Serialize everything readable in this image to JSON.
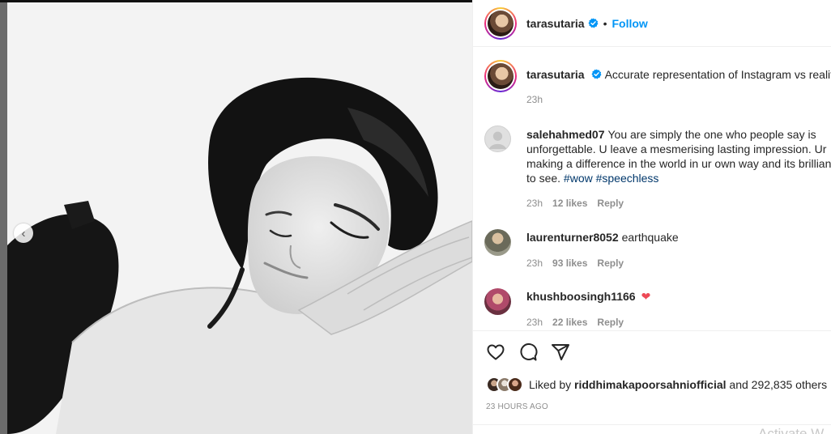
{
  "post": {
    "image_alt": "Black and white portrait of a woman resting her head on her hands"
  },
  "header": {
    "username": "tarasutaria",
    "separator": "•",
    "follow_label": "Follow"
  },
  "caption": {
    "username": "tarasutaria",
    "text": "Accurate representation of Instagram vs reality",
    "time": "23h"
  },
  "comments": [
    {
      "username": "salehahmed07",
      "lines": [
        "You are simply the one who people say is",
        "unforgettable. U leave a mesmerising lasting impression. Ur",
        "making a difference in the world in ur own way and its brilliant",
        "to see."
      ],
      "hashtags": [
        "#wow",
        "#speechless"
      ],
      "time": "23h",
      "likes": "12 likes",
      "reply": "Reply"
    },
    {
      "username": "laurenturner8052",
      "text": "earthquake",
      "time": "23h",
      "likes": "93 likes",
      "reply": "Reply"
    },
    {
      "username": "khushboosingh1166",
      "text": "❤",
      "time": "23h",
      "likes": "22 likes",
      "reply": "Reply"
    }
  ],
  "likes": {
    "prefix": "Liked by",
    "user": "riddhimakapoorsahniofficial",
    "suffix": "and 292,835 others"
  },
  "timestamp": "23 HOURS AGO",
  "watermark": "Activate W",
  "colors": {
    "accent": "#0095f6",
    "text": "#262626",
    "secondary": "#8e8e8e",
    "hashtag": "#00376b",
    "heart": "#ed4956"
  },
  "icons": [
    "chevron-left-icon",
    "verified-badge-icon",
    "heart-icon",
    "comment-icon",
    "share-icon"
  ]
}
